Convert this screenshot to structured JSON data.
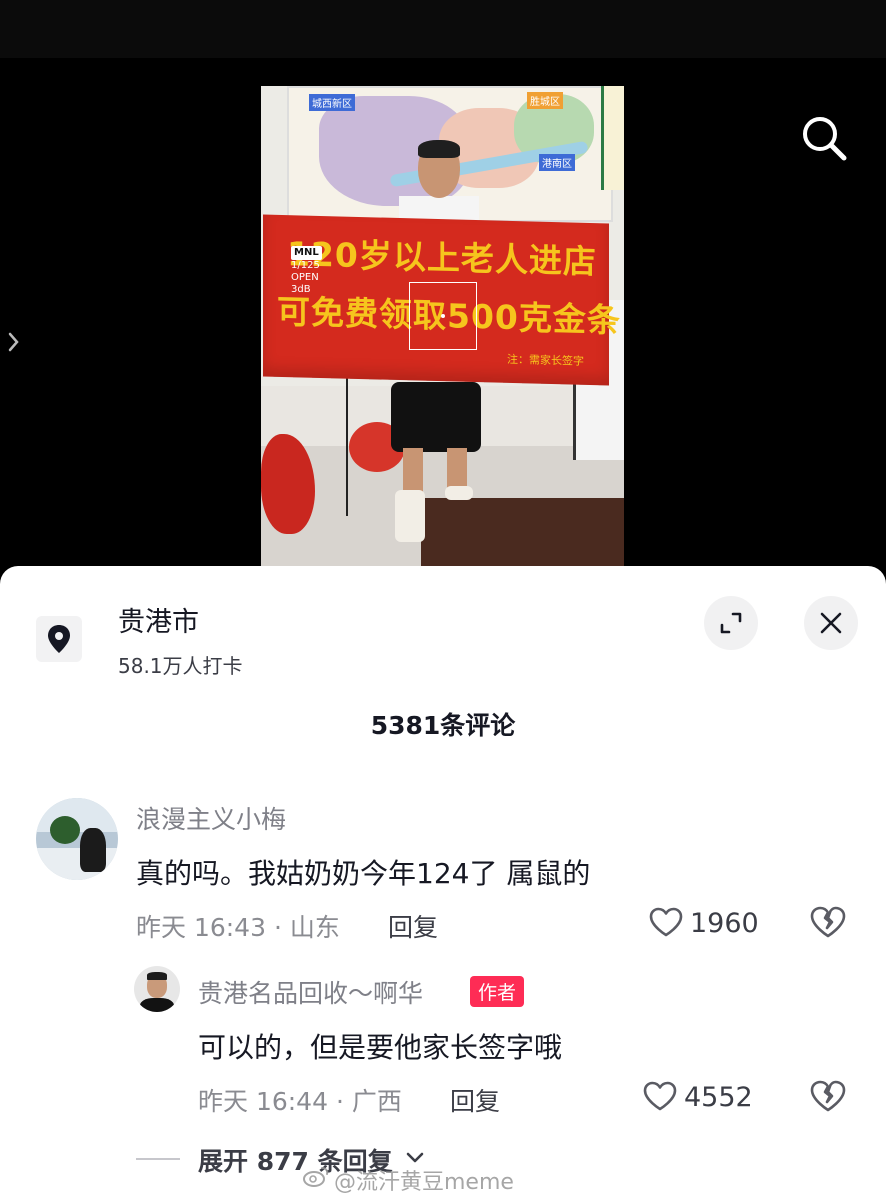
{
  "video": {
    "banner_line1": "120岁以上老人进店",
    "banner_line2": "可免费领取500克金条",
    "banner_sign": "注：需家长签字",
    "map_label_1": "城西新区",
    "map_label_2": "胜城区",
    "map_label_3": "港南区",
    "camera_brand": "MNL",
    "camera_shutter": "1/125",
    "camera_aperture": "OPEN",
    "camera_gain": "3dB"
  },
  "location": {
    "name": "贵港市",
    "checkins": "58.1万人打卡"
  },
  "comments_header": "5381条评论",
  "comments": [
    {
      "username": "浪漫主义小梅",
      "text": "真的吗。我姑奶奶今年124了 属鼠的",
      "meta": "昨天 16:43 · 山东",
      "reply_label": "回复",
      "likes": "1960"
    },
    {
      "username": "贵港名品回收～啊华",
      "author_tag": "作者",
      "text": "可以的，但是要他家长签字哦",
      "meta": "昨天 16:44 · 广西",
      "reply_label": "回复",
      "likes": "4552"
    }
  ],
  "expand_replies": "展开 877 条回复",
  "watermark": "@流汗黄豆meme",
  "icons": {
    "search": "search-icon",
    "location": "location-pin-icon",
    "expand": "expand-icon",
    "close": "close-icon",
    "like": "heart-icon",
    "dislike": "broken-heart-icon",
    "chevron": "chevron-down-icon"
  },
  "colors": {
    "accent": "#fe2c55",
    "banner_red": "#d42a1e",
    "banner_text": "#f6c51d"
  }
}
